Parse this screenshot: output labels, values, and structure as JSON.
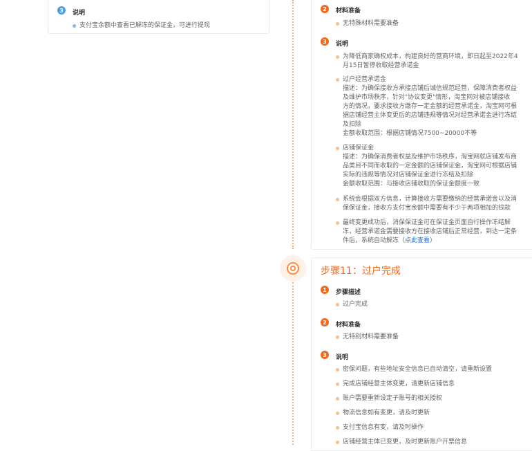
{
  "left_card": {
    "sec3_num": "3",
    "sec3_title": "说明",
    "item": "支付宝余额中查看已解冻的保证金，可进行提现"
  },
  "step10": {
    "sec2_num": "2",
    "sec2_title": "材料准备",
    "sec2_item": "无特殊材料需要准备",
    "sec3_num": "3",
    "sec3_title": "说明",
    "notes": {
      "n1": [
        "为降低商家确权成本，构建良好的营商环境，即日起至2022年4",
        "月15日暂停收取经营承诺金"
      ],
      "n2": [
        "过户经营承诺金",
        "描述：为确保接收方承接店铺后诚信规范经营，保障消费者权益",
        "及维护市场秩序，针对\"协议变更\"情形，淘宝网对被店铺接收",
        "方的情况，要求接收方缴存一定金额的经营承诺金，淘宝网可根",
        "据店铺经营主体变更后的店铺违规等情况对经营承诺金进行冻结",
        "及扣除",
        "金额收取范围：根据店铺情况7500~20000不等"
      ],
      "n3": [
        "店铺保证金",
        "描述：为确保消费者权益及维护市场秩序，淘宝网就店铺发布商",
        "品类目不同而收取的一定金额的店铺保证金，淘宝网可根据店铺",
        "实际的违规等情况对店铺保证金进行冻结及扣除",
        "金额收取范围：与接收店铺收取的保证金额度一致"
      ],
      "n4": [
        "系统会根据双方信息，计算接收方需要缴纳的经营承诺金以及消",
        "保保证金，接收方支付宝余额中需要有不少于两项相加的钱款"
      ],
      "n5a": [
        "最终变更成功后，消保保证金可在保证金页面自行操作冻结解",
        "冻，经营承诺金需要接收方在接收店铺后正常经营，到达一定条"
      ],
      "n5b_prefix": "件后，系统自动解冻（",
      "n5b_link": "点此查看",
      "n5b_suffix": "）"
    }
  },
  "step11": {
    "title": "步骤11：过户完成",
    "sec1_num": "1",
    "sec1_title": "步骤描述",
    "sec1_item": "过户完成",
    "sec2_num": "2",
    "sec2_title": "材料准备",
    "sec2_item": "无特别材料需要准备",
    "sec3_num": "3",
    "sec3_title": "说明",
    "items": [
      "密保问题，有些地址安全信息已自动清空，请重新设置",
      "完成店铺经营主体变更，请更新店铺信息",
      "账户需要重新设定子账号的相关授权",
      "物流信息如有变更，请及时更新",
      "支付宝信息有变，请及时操作",
      "店铺经营主体已变更，及时更新账户开票信息"
    ]
  }
}
